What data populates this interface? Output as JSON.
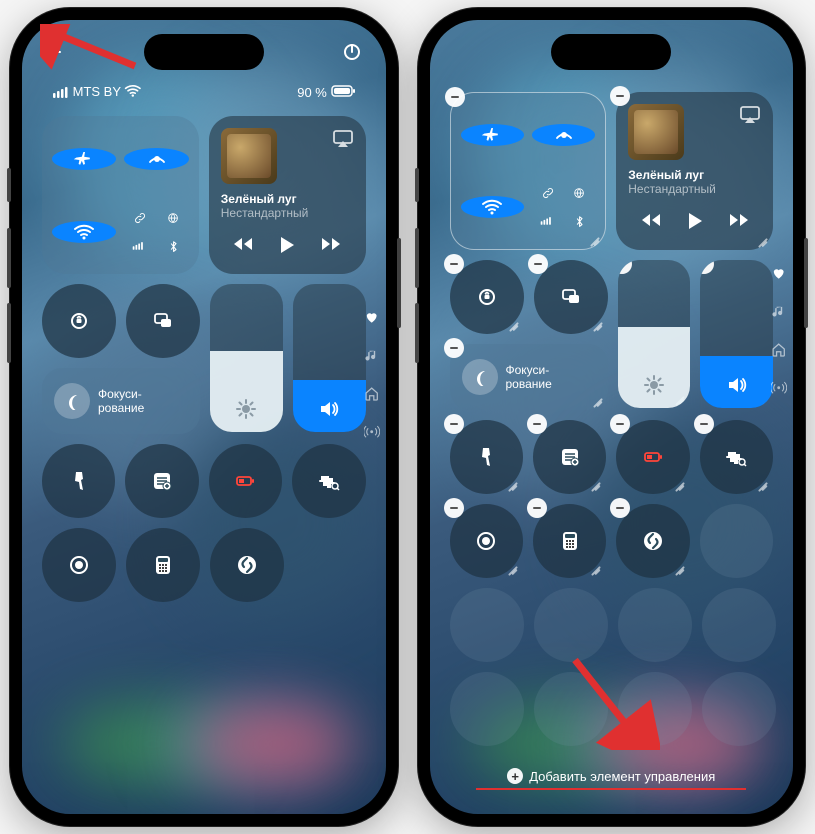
{
  "left": {
    "carrier": "MTS BY",
    "battery_pct": "90 %",
    "now_playing": {
      "title": "Зелёный луг",
      "subtitle": "Нестандартный"
    },
    "focus_label": "Фокуси-\nрование",
    "brightness_fill_pct": 55,
    "volume_fill_pct": 35
  },
  "right": {
    "now_playing": {
      "title": "Зелёный луг",
      "subtitle": "Нестандартный"
    },
    "focus_label": "Фокуси-\nрование",
    "brightness_fill_pct": 55,
    "volume_fill_pct": 35,
    "add_control_label": "Добавить элемент управления"
  },
  "icons": {
    "plus": "plus-icon",
    "power": "power-icon",
    "airplane": "airplane-icon",
    "airdrop": "airdrop-icon",
    "wifi": "wifi-icon",
    "cellular_bt": "cellular-bluetooth-icon",
    "airplay": "airplay-icon",
    "rewind": "rewind-icon",
    "play": "play-icon",
    "forward": "forward-icon",
    "rotation_lock": "rotation-lock-icon",
    "screen_mirror": "screen-mirroring-icon",
    "moon": "moon-icon",
    "sun": "sun-icon",
    "speaker": "speaker-icon",
    "flashlight": "flashlight-icon",
    "notes": "notes-icon",
    "low_power": "low-power-icon",
    "sound_recognition": "sound-recognition-icon",
    "record": "screen-record-icon",
    "calculator": "calculator-icon",
    "shazam": "shazam-icon",
    "heart": "favorites-icon",
    "music_note": "music-icon",
    "home": "home-icon",
    "broadcast": "broadcast-icon"
  },
  "colors": {
    "blue": "#0a84ff",
    "green": "#30d158",
    "arrow_red": "#e03030"
  }
}
